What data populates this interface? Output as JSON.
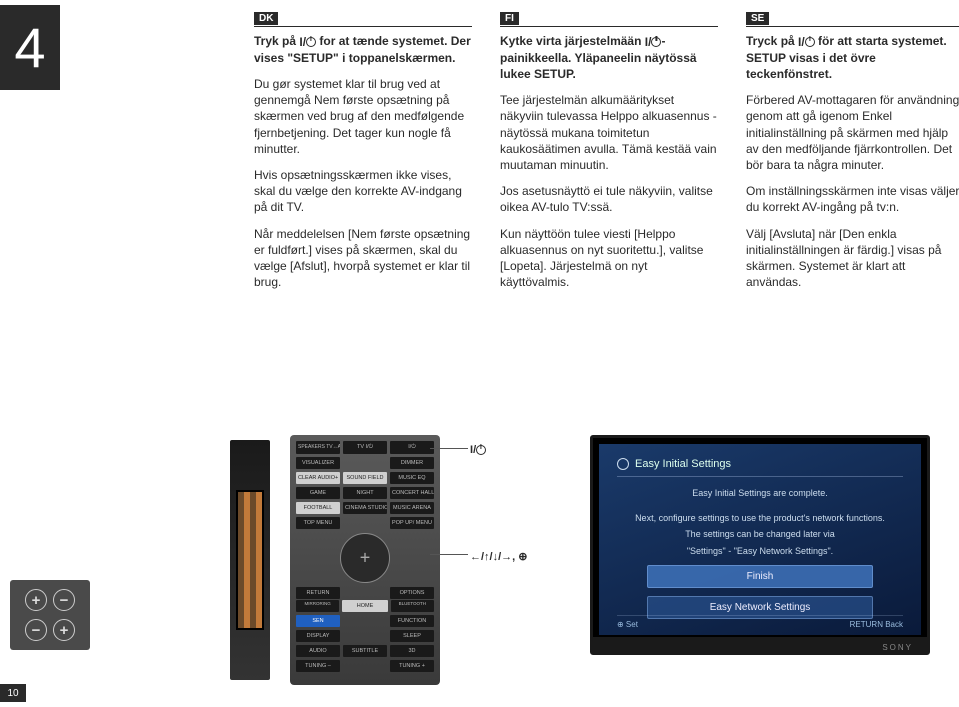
{
  "step_number": "4",
  "page_number": "10",
  "columns": [
    {
      "lang": "DK",
      "p1_pre": "Tryk på ",
      "p1_post": " for at tænde systemet. Der vises \"SETUP\" i toppanelskærmen.",
      "p2": "Du gør systemet klar til brug ved at gennemgå Nem første opsætning på skærmen ved brug af den medfølgende fjernbetjening. Det tager kun nogle få minutter.",
      "p3": "Hvis opsætningsskærmen ikke vises, skal du vælge den korrekte AV-indgang på dit TV.",
      "p4": "Når meddelelsen [Nem første opsætning er fuldført.] vises på skærmen, skal du vælge [Afslut], hvorpå systemet er klar til brug."
    },
    {
      "lang": "FI",
      "p1_pre": "Kytke virta järjestelmään ",
      "p1_post": "-painikkeella. Yläpaneelin näytössä lukee SETUP.",
      "p2": "Tee järjestelmän alkumääritykset näkyviin tulevassa Helppo alkuasennus -näytössä mukana toimitetun kaukosäätimen avulla. Tämä kestää vain muutaman minuutin.",
      "p3": "Jos asetusnäyttö ei tule näkyviin, valitse oikea AV-tulo TV:ssä.",
      "p4": "Kun näyttöön tulee viesti [Helppo alkuasennus on nyt suoritettu.], valitse [Lopeta]. Järjestelmä on nyt käyttövalmis."
    },
    {
      "lang": "SE",
      "p1_pre": "Tryck på ",
      "p1_post": " för att starta systemet. SETUP visas i det övre teckenfönstret.",
      "p2": "Förbered AV-mottagaren för användning genom att gå igenom Enkel initialinställning på skärmen med hjälp av den medföljande fjärrkontrollen. Det bör bara ta några minuter.",
      "p3": "Om inställningsskärmen inte visas väljer du korrekt AV-ingång på tv:n.",
      "p4": "Välj [Avsluta] när [Den enkla initialinställningen är färdig.] visas på skärmen. Systemet är klart att användas."
    }
  ],
  "remote": {
    "row_top": [
      "SPEAKERS TV↔AUDIO",
      "TV I/⏻",
      "I/⏻"
    ],
    "row1": [
      "VISUALIZER",
      "",
      "DIMMER"
    ],
    "row2": [
      "CLEAR AUDIO+",
      "SOUND FIELD",
      "MUSIC EQ"
    ],
    "row3": [
      "GAME",
      "NIGHT",
      "CONCERT HALL"
    ],
    "row4": [
      "FOOTBALL",
      "CINEMA STUDIO",
      "MUSIC ARENA"
    ],
    "row5": [
      "TOP MENU",
      "",
      "POP UP/ MENU"
    ],
    "row6": [
      "RETURN",
      "",
      "OPTIONS"
    ],
    "row6b": [
      "MIRRORING",
      "",
      "BLUETOOTH"
    ],
    "home": "HOME",
    "row7": [
      "SEN",
      "",
      "FUNCTION"
    ],
    "row8": [
      "DISPLAY",
      "",
      "SLEEP"
    ],
    "row9": [
      "AUDIO",
      "SUBTITLE",
      "3D"
    ],
    "row10": [
      "TUNING –",
      "",
      "TUNING +"
    ]
  },
  "callouts": {
    "power_prefix": "",
    "arrows": "←/↑/↓/→, ⊕"
  },
  "tv": {
    "title": "Easy Initial Settings",
    "line1": "Easy Initial Settings are complete.",
    "line2": "Next, configure settings to use the product's network functions.",
    "line3": "The settings can be changed later via",
    "line4": "\"Settings\" - \"Easy Network Settings\".",
    "btn1": "Finish",
    "btn2": "Easy Network Settings",
    "footer_left": "⊕ Set",
    "footer_right": "RETURN Back",
    "brand": "SONY"
  },
  "battery": {
    "plus": "+",
    "minus": "−"
  }
}
